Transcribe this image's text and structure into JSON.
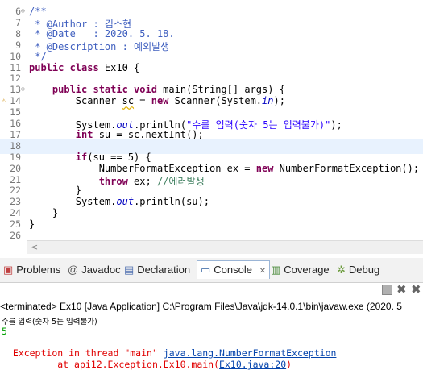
{
  "editor": {
    "lines": [
      {
        "n": "6",
        "fold": "⊖",
        "html": "<span class='jd'>/**</span>"
      },
      {
        "n": "7",
        "html": "<span class='jd'> * @Author : 김소현</span>"
      },
      {
        "n": "8",
        "html": "<span class='jd'> * @Date   : 2020. 5. 18.</span>"
      },
      {
        "n": "9",
        "html": "<span class='jd'> * @Description : 예외발생</span>"
      },
      {
        "n": "10",
        "html": "<span class='jd'> */</span>"
      },
      {
        "n": "11",
        "html": "<span class='kw'>public class</span> Ex10 {"
      },
      {
        "n": "12",
        "html": ""
      },
      {
        "n": "13",
        "fold": "⊖",
        "html": "    <span class='kw'>public static void</span> main(String[] args) {"
      },
      {
        "n": "14",
        "warn": true,
        "html": "        Scanner <span class='uvar'>sc</span> = <span class='kw'>new</span> Scanner(System.<span class='fld'>in</span>);"
      },
      {
        "n": "15",
        "html": ""
      },
      {
        "n": "16",
        "html": "        System.<span class='fld'>out</span>.println(<span class='str'>\"수를 입력(숫자 5는 입력불가)\"</span>);"
      },
      {
        "n": "17",
        "html": "        <span class='kw'>int</span> su = sc.nextInt();"
      },
      {
        "n": "18",
        "cur": true,
        "html": ""
      },
      {
        "n": "19",
        "html": "        <span class='kw'>if</span>(su == 5) {"
      },
      {
        "n": "20",
        "html": "            NumberFormatException ex = <span class='kw'>new</span> NumberFormatException();"
      },
      {
        "n": "21",
        "html": "            <span class='kw'>throw</span> ex; <span class='cm'>//에러발생</span>"
      },
      {
        "n": "22",
        "html": "        }"
      },
      {
        "n": "23",
        "html": "        System.<span class='fld'>out</span>.println(su);"
      },
      {
        "n": "24",
        "html": "    }"
      },
      {
        "n": "25",
        "html": "}"
      },
      {
        "n": "26",
        "html": ""
      }
    ]
  },
  "tabs": [
    {
      "label": "Problems",
      "icon": "▣",
      "icon_color": "#c04040"
    },
    {
      "label": "Javadoc",
      "icon": "@",
      "icon_color": "#555"
    },
    {
      "label": "Declaration",
      "icon": "▤",
      "icon_color": "#5070b0"
    },
    {
      "label": "Console",
      "icon": "▭",
      "icon_color": "#3060a0",
      "close": "✕"
    },
    {
      "label": "Coverage",
      "icon": "▥",
      "icon_color": "#4a8a3a"
    },
    {
      "label": "Debug",
      "icon": "✲",
      "icon_color": "#6a9a3a"
    }
  ],
  "console": {
    "header": "<terminated> Ex10 [Java Application] C:\\Program Files\\Java\\jdk-14.0.1\\bin\\javaw.exe  (2020. 5",
    "prompt": "수를 입력(숫자 5는 입력불가)",
    "input": "5",
    "exception_prefix": "Exception in thread \"main\" ",
    "exception_class": "java.lang.NumberFormatException",
    "trace_prefix": "        at api12.Exception.Ex10.main(",
    "trace_link": "Ex10.java:20",
    "trace_suffix": ")"
  }
}
